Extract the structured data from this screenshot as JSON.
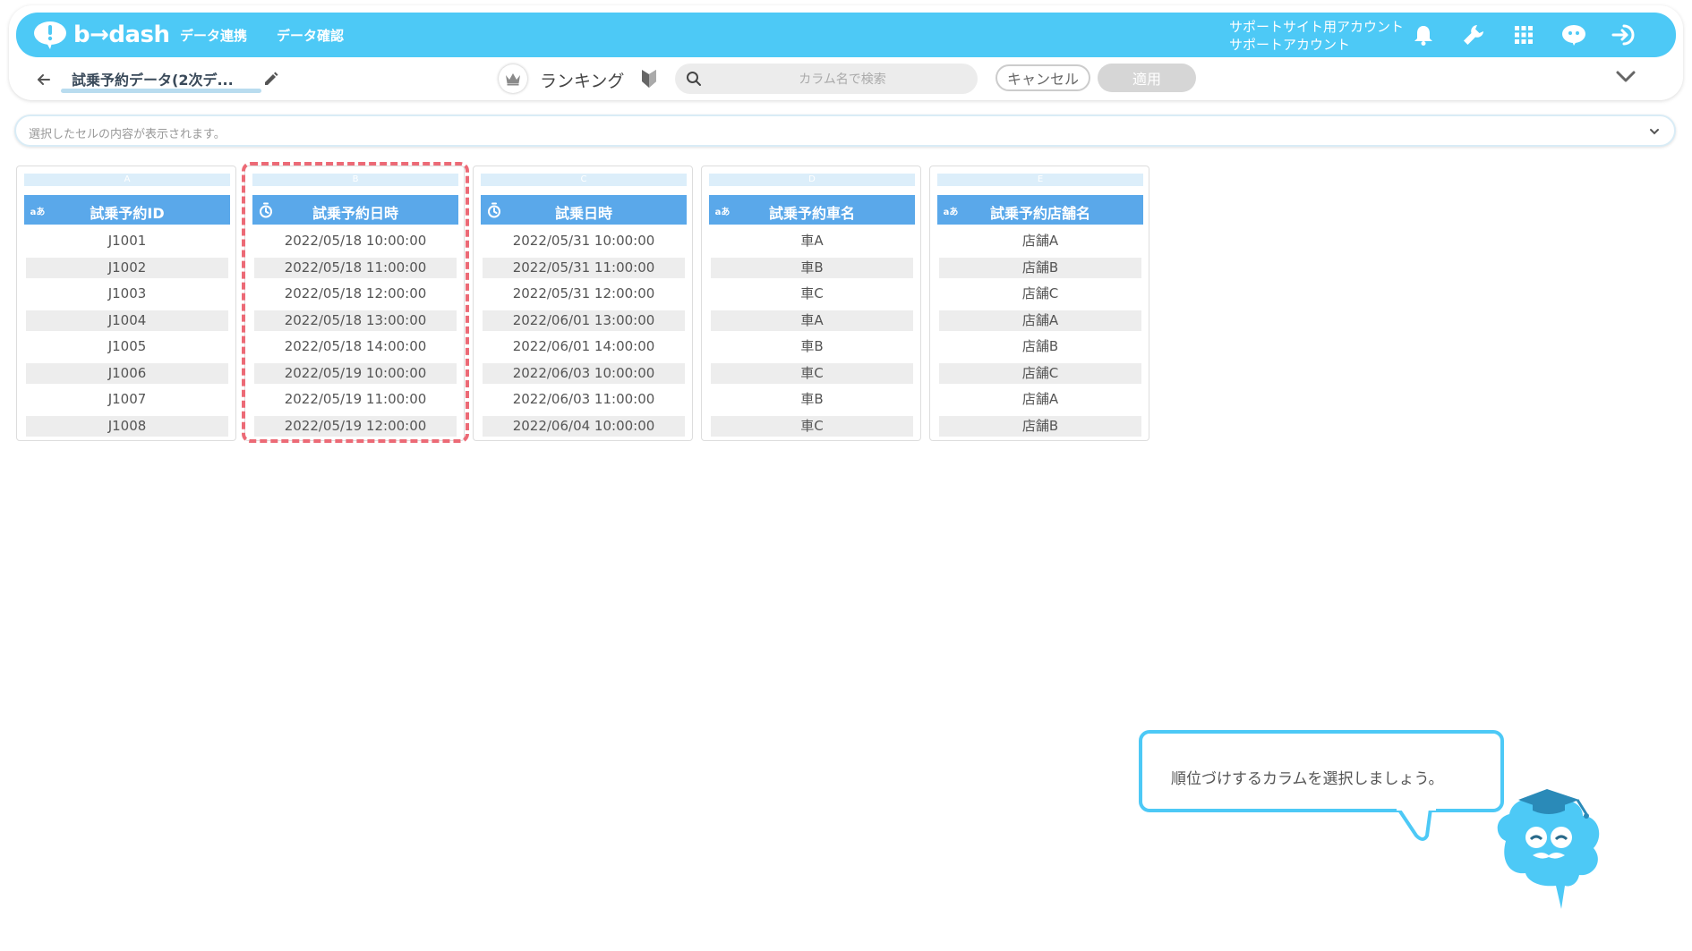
{
  "app": {
    "logo_text": "b→dash",
    "nav": [
      "データ連携",
      "データ確認"
    ],
    "account_line1": "サポートサイト用アカウント",
    "account_line2": "サポートアカウント",
    "brand_color": "#4dc9f6"
  },
  "toolbar": {
    "dataset_name": "試乗予約データ(2次デ...",
    "mode_label": "ランキング",
    "search_placeholder": "カラム名で検索",
    "cancel_label": "キャンセル",
    "apply_label": "適用"
  },
  "cellbar": {
    "placeholder": "選択したセルの内容が表示されます。"
  },
  "columns": [
    {
      "letter": "A",
      "type_icon": "text-type-icon",
      "type_label": "aあ",
      "name": "試乗予約ID",
      "values": [
        "J1001",
        "J1002",
        "J1003",
        "J1004",
        "J1005",
        "J1006",
        "J1007",
        "J1008"
      ]
    },
    {
      "letter": "B",
      "type_icon": "datetime-type-icon",
      "type_label": "",
      "name": "試乗予約日時",
      "values": [
        "2022/05/18 10:00:00",
        "2022/05/18 11:00:00",
        "2022/05/18 12:00:00",
        "2022/05/18 13:00:00",
        "2022/05/18 14:00:00",
        "2022/05/19 10:00:00",
        "2022/05/19 11:00:00",
        "2022/05/19 12:00:00"
      ]
    },
    {
      "letter": "C",
      "type_icon": "datetime-type-icon",
      "type_label": "",
      "name": "試乗日時",
      "values": [
        "2022/05/31 10:00:00",
        "2022/05/31 11:00:00",
        "2022/05/31 12:00:00",
        "2022/06/01 13:00:00",
        "2022/06/01 14:00:00",
        "2022/06/03 10:00:00",
        "2022/06/03 11:00:00",
        "2022/06/04 10:00:00"
      ]
    },
    {
      "letter": "D",
      "type_icon": "text-type-icon",
      "type_label": "aあ",
      "name": "試乗予約車名",
      "values": [
        "車A",
        "車B",
        "車C",
        "車A",
        "車B",
        "車C",
        "車B",
        "車C"
      ]
    },
    {
      "letter": "E",
      "type_icon": "text-type-icon",
      "type_label": "aあ",
      "name": "試乗予約店舗名",
      "values": [
        "店舗A",
        "店舗B",
        "店舗C",
        "店舗A",
        "店舗B",
        "店舗C",
        "店舗A",
        "店舗B"
      ]
    }
  ],
  "tutorial": {
    "message": "順位づけするカラムを選択しましょう。",
    "highlight_color": "#ec6a76"
  }
}
